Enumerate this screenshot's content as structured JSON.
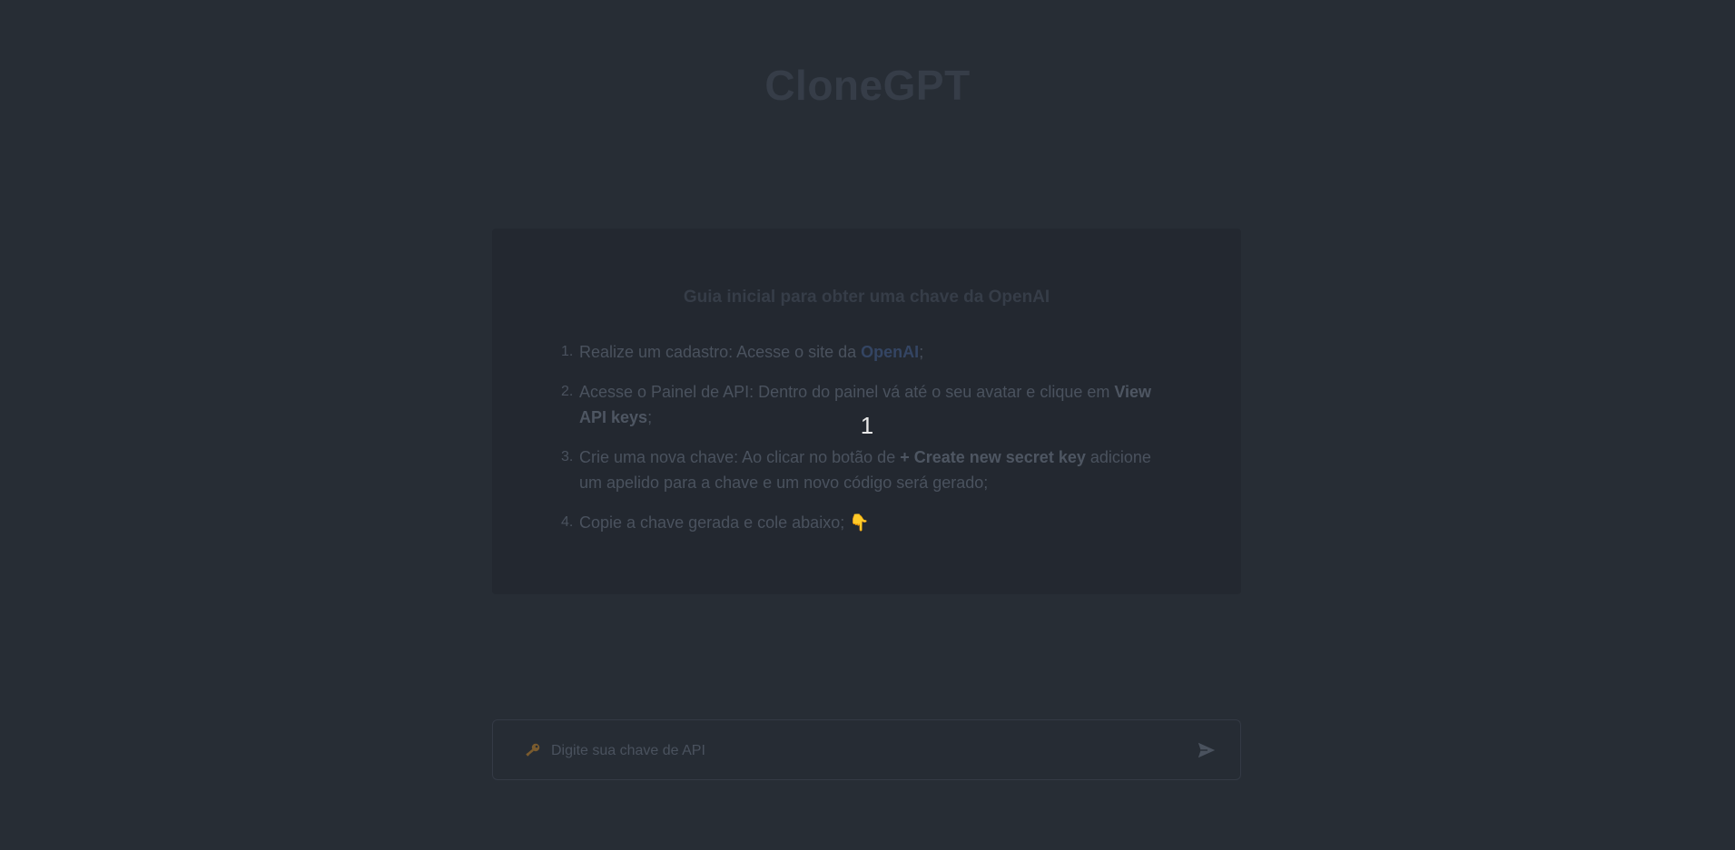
{
  "app": {
    "title": "CloneGPT"
  },
  "guide": {
    "title": "Guia inicial para obter uma chave da OpenAI",
    "steps": [
      {
        "num": "1.",
        "text_before": "Realize um cadastro: Acesse o site da ",
        "link": "OpenAI",
        "text_after": ";"
      },
      {
        "num": "2.",
        "text_before": "Acesse o Painel de API: Dentro do painel vá até o seu avatar e clique em ",
        "bold": "View API keys",
        "text_after": ";"
      },
      {
        "num": "3.",
        "text_before": "Crie uma nova chave: Ao clicar no botão de ",
        "bold": "+ Create new secret key",
        "text_after": " adicione um apelido para a chave e um novo código será gerado;"
      },
      {
        "num": "4.",
        "text_before": "Copie a chave gerada e cole abaixo; ",
        "emoji": "👇"
      }
    ]
  },
  "overlay": {
    "number": "1"
  },
  "api_key_input": {
    "placeholder": "Digite sua chave de API",
    "value": "",
    "icon": "key-icon",
    "submit_icon": "send-icon"
  },
  "colors": {
    "background": "#272d35",
    "card": "#232830",
    "link": "#344563",
    "text": "#4a525e"
  }
}
